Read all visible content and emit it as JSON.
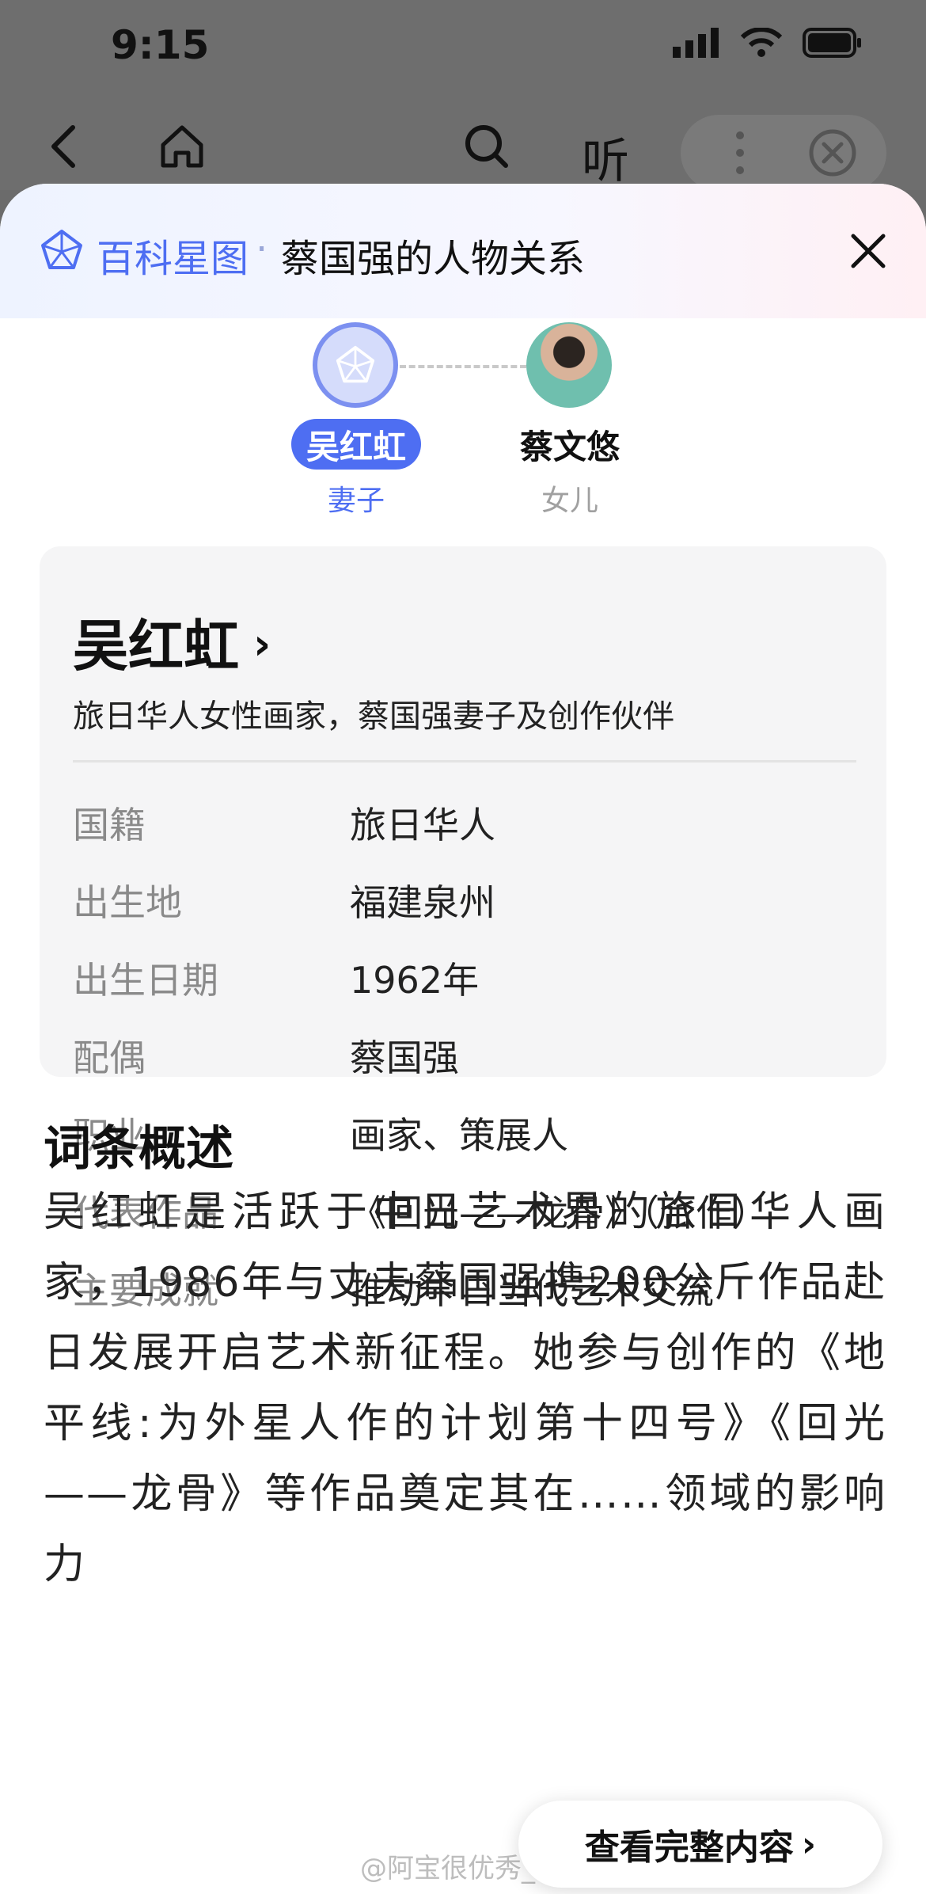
{
  "status": {
    "time": "9:15"
  },
  "nav": {
    "listen_label": "听"
  },
  "sheet": {
    "brand": "百科星图",
    "separator": "·",
    "title": "蔡国强的人物关系"
  },
  "people": [
    {
      "name": "吴红虹",
      "role": "妻子"
    },
    {
      "name": "蔡文悠",
      "role": "女儿"
    }
  ],
  "card": {
    "name": "吴红虹",
    "chevron": "›",
    "subtitle": "旅日华人女性画家，蔡国强妻子及创作伙伴",
    "rows": [
      {
        "key": "国籍",
        "value": "旅日华人"
      },
      {
        "key": "出生地",
        "value": "福建泉州"
      },
      {
        "key": "出生日期",
        "value": "1962年"
      },
      {
        "key": "配偶",
        "value": "蔡国强"
      },
      {
        "key": "职业",
        "value": "画家、策展人"
      },
      {
        "key": "代表作品",
        "value": "《回光——龙骨》（合作）"
      },
      {
        "key": "主要成就",
        "value": "推动中日当代艺术交流"
      }
    ]
  },
  "overview": {
    "title": "词条概述",
    "text": "吴红虹是活跃于中日艺术界的旅日华人画家，1986年与丈夫蔡国强携200公斤作品赴日发展开启艺术新征程。她参与创作的《地平线:为外星人作的计划第十四号》《回光——龙骨》等作品奠定其在……领域的影响力"
  },
  "more_button": {
    "label": "查看完整内容",
    "chevron": "›"
  },
  "watermark": "@阿宝很优秀_",
  "colors": {
    "accent": "#4e6ef2",
    "background_dim": "#6e6e6e"
  }
}
